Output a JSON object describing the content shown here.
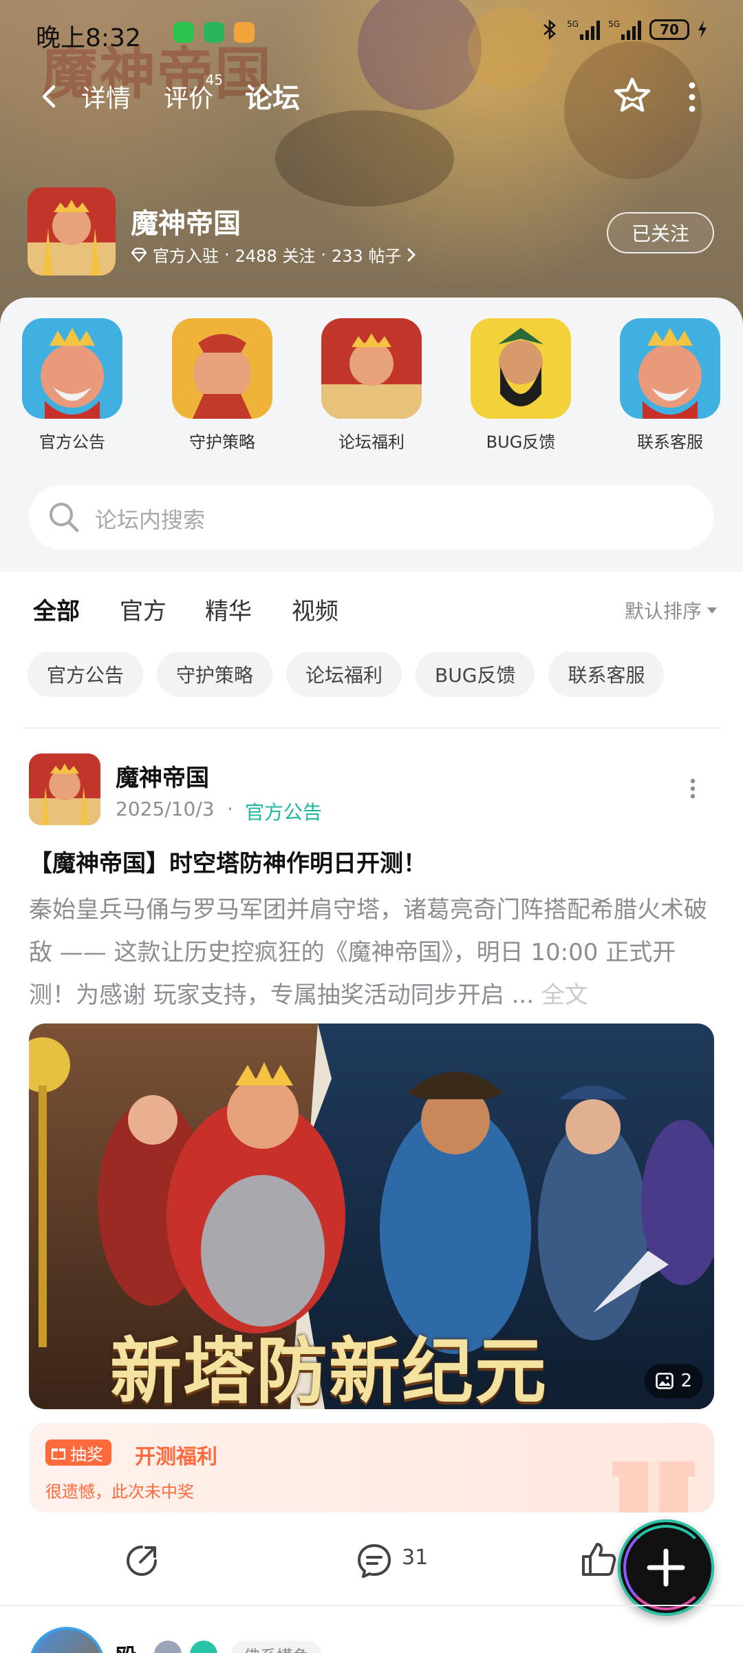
{
  "status_bar": {
    "time": "晚上8:32",
    "network_1": "5G",
    "network_2": "5G",
    "battery": "70"
  },
  "nav": {
    "tabs": [
      {
        "label": "详情"
      },
      {
        "label": "评价",
        "badge": "45"
      },
      {
        "label": "论坛"
      }
    ],
    "active_tab": "论坛"
  },
  "game": {
    "name": "魔神帝国",
    "watermark": "魔神帝国",
    "official": "官方入驻",
    "followers": "2488 关注",
    "posts": "233 帖子",
    "follow_label": "已关注",
    "separator": "·"
  },
  "shortcuts": [
    {
      "label": "官方公告"
    },
    {
      "label": "守护策略"
    },
    {
      "label": "论坛福利"
    },
    {
      "label": "BUG反馈"
    },
    {
      "label": "联系客服"
    }
  ],
  "search": {
    "placeholder": "论坛内搜索"
  },
  "filter_tabs": [
    {
      "label": "全部"
    },
    {
      "label": "官方"
    },
    {
      "label": "精华"
    },
    {
      "label": "视频"
    }
  ],
  "sort_label": "默认排序",
  "chips": [
    {
      "label": "官方公告"
    },
    {
      "label": "守护策略"
    },
    {
      "label": "论坛福利"
    },
    {
      "label": "BUG反馈"
    },
    {
      "label": "联系客服"
    }
  ],
  "post": {
    "author": "魔神帝国",
    "date": "2025/10/3",
    "separator": "·",
    "category": "官方公告",
    "title": "【魔神帝国】时空塔防神作明日开测！",
    "body": "秦始皇兵马俑与罗马军团并肩守塔，诸葛亮奇门阵搭配希腊火术破敌 —— 这款让历史控疯狂的《魔神帝国》，明日 10:00 正式开测！为感谢 玩家支持，专属抽奖活动同步开启 ...",
    "full_text_label": "全文",
    "image_text": "新塔防新纪元",
    "image_count": "2",
    "lottery": {
      "badge": "抽奖",
      "title": "开测福利",
      "result": "很遗憾，此次未中奖"
    },
    "comment_count": "31"
  },
  "next_post": {
    "name": "殴",
    "tag": "佛系摸鱼"
  },
  "colors": {
    "accent": "#27c4a8",
    "lottery": "#ff6a3d",
    "muted_text": "#8a8d92"
  }
}
